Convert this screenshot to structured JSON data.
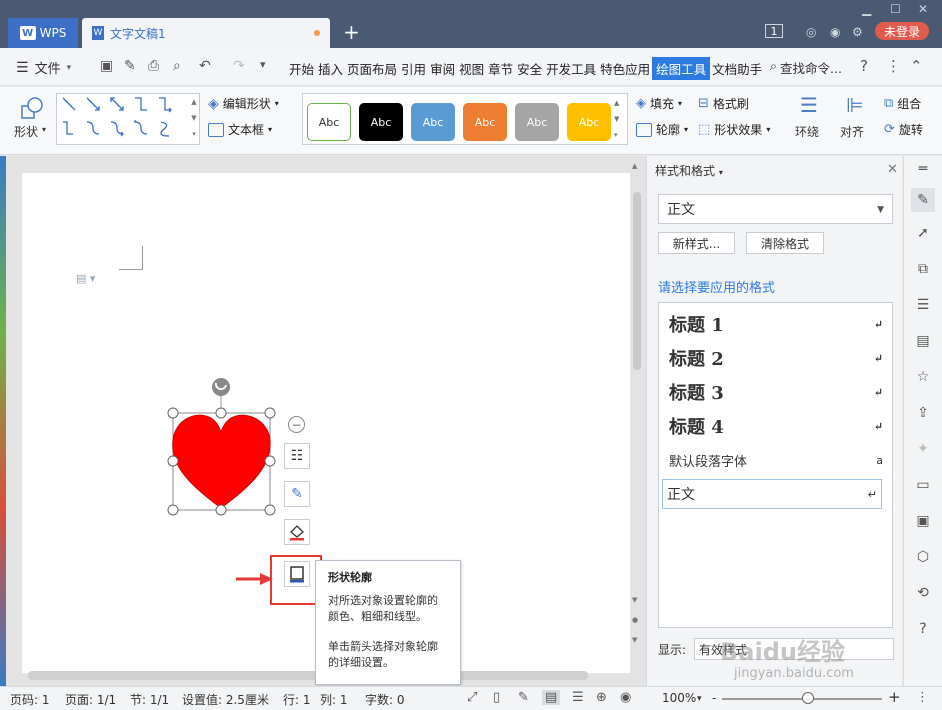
{
  "titlebar": {
    "app_tab": "WPS",
    "doc_tab": "文字文稿1",
    "new_tab": "+",
    "badge": "1",
    "login": "未登录"
  },
  "menubar": {
    "file": "文件",
    "tabs": [
      "开始",
      "插入",
      "页面布局",
      "引用",
      "审阅",
      "视图",
      "章节",
      "安全",
      "开发工具",
      "特色应用",
      "绘图工具",
      "文档助手"
    ],
    "active_tab": "绘图工具",
    "search": "查找命令...",
    "help": "?"
  },
  "ribbon": {
    "shape": "形状",
    "edit_shape": "编辑形状",
    "textbox": "文本框",
    "style_label": "Abc",
    "fill": "填充",
    "format_brush": "格式刷",
    "outline": "轮廓",
    "shape_effect": "形状效果",
    "wrap": "环绕",
    "align": "对齐",
    "group": "组合",
    "rotate": "旋转"
  },
  "swatches": [
    {
      "bg": "#ffffff",
      "fg": "#333333",
      "border": "#6ab04c"
    },
    {
      "bg": "#000000",
      "fg": "#ffffff",
      "border": "#000000"
    },
    {
      "bg": "#5b9bd5",
      "fg": "#ffffff",
      "border": "#4a8ac4"
    },
    {
      "bg": "#ed7d31",
      "fg": "#ffffff",
      "border": "#d06a24"
    },
    {
      "bg": "#a5a5a5",
      "fg": "#ffffff",
      "border": "#8f8f8f"
    },
    {
      "bg": "#ffc000",
      "fg": "#ffffff",
      "border": "#e0a800"
    }
  ],
  "tooltip": {
    "title": "形状轮廓",
    "line1": "对所选对象设置轮廓的",
    "line2": "颜色、粗细和线型。",
    "line3": "单击箭头选择对象轮廓",
    "line4": "的详细设置。"
  },
  "panel": {
    "title": "样式和格式",
    "current_style": "正文",
    "new_style": "新样式...",
    "clear_format": "清除格式",
    "apply_label": "请选择要应用的格式",
    "items": [
      {
        "label": "标题  1",
        "mark": "↵"
      },
      {
        "label": "标题  2",
        "mark": "↵"
      },
      {
        "label": "标题  3",
        "mark": "↵"
      },
      {
        "label": "标题  4",
        "mark": "↵"
      },
      {
        "label": "默认段落字体",
        "mark": "a"
      },
      {
        "label": "正文",
        "mark": "↵"
      }
    ],
    "show_label": "显示:",
    "show_value": "有效样式"
  },
  "statusbar": {
    "page_no": "页码: 1",
    "pages": "页面: 1/1",
    "section": "节: 1/1",
    "setting": "设置值: 2.5厘米",
    "row": "行: 1",
    "col": "列: 1",
    "words": "字数: 0",
    "zoom": "100%",
    "zoom_minus": "-",
    "zoom_plus": "+"
  },
  "watermark": {
    "brand": "Baidu经验",
    "url": "jingyan.baidu.com"
  },
  "colors": {
    "heart": "#ff0000",
    "highlight": "#e53935",
    "accent": "#2d7be0"
  }
}
